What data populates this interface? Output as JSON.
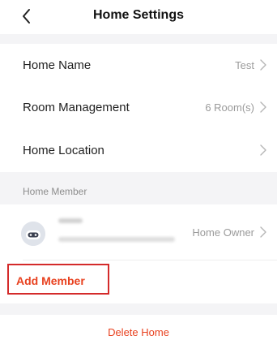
{
  "header": {
    "title": "Home Settings",
    "back_icon": "chevron-left-icon"
  },
  "settings": {
    "home_name": {
      "label": "Home Name",
      "value": "Test"
    },
    "room_management": {
      "label": "Room Management",
      "value": "6 Room(s)"
    },
    "home_location": {
      "label": "Home Location",
      "value": ""
    }
  },
  "members": {
    "section_label": "Home Member",
    "list": [
      {
        "role": "Home Owner",
        "avatar_icon": "robot-avatar-icon"
      }
    ],
    "add_label": "Add Member"
  },
  "delete_label": "Delete Home",
  "colors": {
    "accent": "#e8411f",
    "highlight_border": "#d42a2a",
    "background_gap": "#f4f4f6",
    "muted_text": "#9a9a9a"
  }
}
